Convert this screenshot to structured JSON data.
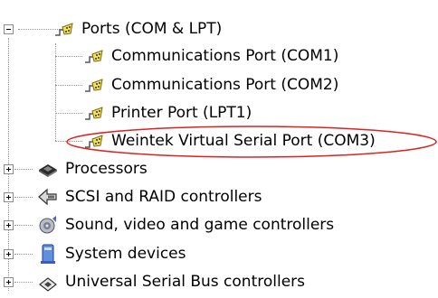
{
  "tree": {
    "ports": {
      "label": "Ports (COM & LPT)",
      "icon": "port-icon",
      "expanded": true
    },
    "children": [
      {
        "label": "Communications Port (COM1)",
        "icon": "port-icon"
      },
      {
        "label": "Communications Port (COM2)",
        "icon": "port-icon"
      },
      {
        "label": "Printer Port (LPT1)",
        "icon": "port-icon"
      },
      {
        "label": "Weintek Virtual Serial Port (COM3)",
        "icon": "port-icon",
        "highlighted": true
      }
    ],
    "categories": [
      {
        "label": "Processors",
        "icon": "processor-icon"
      },
      {
        "label": "SCSI and RAID controllers",
        "icon": "scsi-icon"
      },
      {
        "label": "Sound, video and game controllers",
        "icon": "sound-icon"
      },
      {
        "label": "System devices",
        "icon": "system-devices-icon"
      },
      {
        "label": "Universal Serial Bus controllers",
        "icon": "usb-icon"
      }
    ]
  },
  "colors": {
    "highlight_ellipse": "#e02020",
    "tree_lines": "#9a9a9a"
  }
}
